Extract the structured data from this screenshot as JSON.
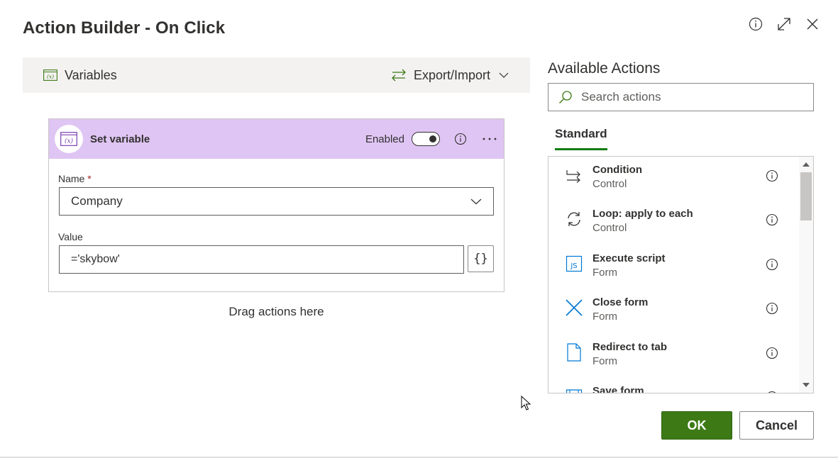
{
  "dialog": {
    "title": "Action Builder - On Click"
  },
  "toolbar": {
    "variables_label": "Variables",
    "export_import_label": "Export/Import"
  },
  "card": {
    "title": "Set variable",
    "enabled_label": "Enabled",
    "enabled": true,
    "name_label": "Name",
    "required_mark": "*",
    "name_value": "Company",
    "value_label": "Value",
    "value_text": "='skybow'",
    "expression_button": "{}"
  },
  "drag_hint": "Drag actions here",
  "available_actions": {
    "title": "Available Actions",
    "search_placeholder": "Search actions",
    "tab": "Standard",
    "items": [
      {
        "name": "Condition",
        "category": "Control",
        "icon": "condition-icon"
      },
      {
        "name": "Loop: apply to each",
        "category": "Control",
        "icon": "loop-icon"
      },
      {
        "name": "Execute script",
        "category": "Form",
        "icon": "js-script-icon"
      },
      {
        "name": "Close form",
        "category": "Form",
        "icon": "close-form-icon"
      },
      {
        "name": "Redirect to tab",
        "category": "Form",
        "icon": "page-icon"
      },
      {
        "name": "Save form",
        "category": "",
        "icon": "save-icon"
      }
    ]
  },
  "footer": {
    "ok_label": "OK",
    "cancel_label": "Cancel"
  },
  "colors": {
    "card_header": "#dfc5f3",
    "primary_button": "#3d7a16",
    "tab_underline": "#107c10",
    "icon_blue": "#0078d4"
  }
}
